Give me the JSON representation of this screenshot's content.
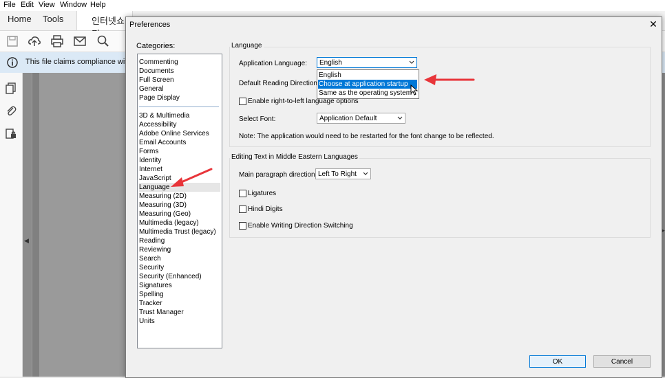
{
  "menubar": {
    "items": [
      "File",
      "Edit",
      "View",
      "Window",
      "Help"
    ]
  },
  "tabs": {
    "home": "Home",
    "tools": "Tools",
    "document": "인터넷쇼핑"
  },
  "infobar": {
    "text": "This file claims compliance with"
  },
  "dialog": {
    "title": "Preferences",
    "categories_label": "Categories:",
    "categories_top": [
      "Commenting",
      "Documents",
      "Full Screen",
      "General",
      "Page Display"
    ],
    "categories": [
      "3D & Multimedia",
      "Accessibility",
      "Adobe Online Services",
      "Email Accounts",
      "Forms",
      "Identity",
      "Internet",
      "JavaScript",
      "Language",
      "Measuring (2D)",
      "Measuring (3D)",
      "Measuring (Geo)",
      "Multimedia (legacy)",
      "Multimedia Trust (legacy)",
      "Reading",
      "Reviewing",
      "Search",
      "Security",
      "Security (Enhanced)",
      "Signatures",
      "Spelling",
      "Tracker",
      "Trust Manager",
      "Units"
    ],
    "selected_category": "Language",
    "language_group": {
      "legend": "Language",
      "app_language_label": "Application Language:",
      "app_language_value": "English",
      "app_language_options": [
        "English",
        "Choose at application startup",
        "Same as the operating system"
      ],
      "app_language_highlighted": "Choose at application startup",
      "reading_direction_label": "Default Reading Direction:",
      "rtl_checkbox": "Enable right-to-left language options",
      "font_label": "Select Font:",
      "font_value": "Application Default",
      "note": "Note: The application would need to be restarted for the font change to be reflected."
    },
    "middle_east_group": {
      "legend": "Editing Text in Middle Eastern Languages",
      "paragraph_label": "Main paragraph direction:",
      "paragraph_value": "Left To Right",
      "ligatures": "Ligatures",
      "hindi_digits": "Hindi Digits",
      "writing_direction": "Enable Writing Direction Switching"
    },
    "ok_label": "OK",
    "cancel_label": "Cancel"
  },
  "colors": {
    "arrow": "#e8353a",
    "highlight": "#0078d7",
    "infobar": "#dbe9f6"
  }
}
